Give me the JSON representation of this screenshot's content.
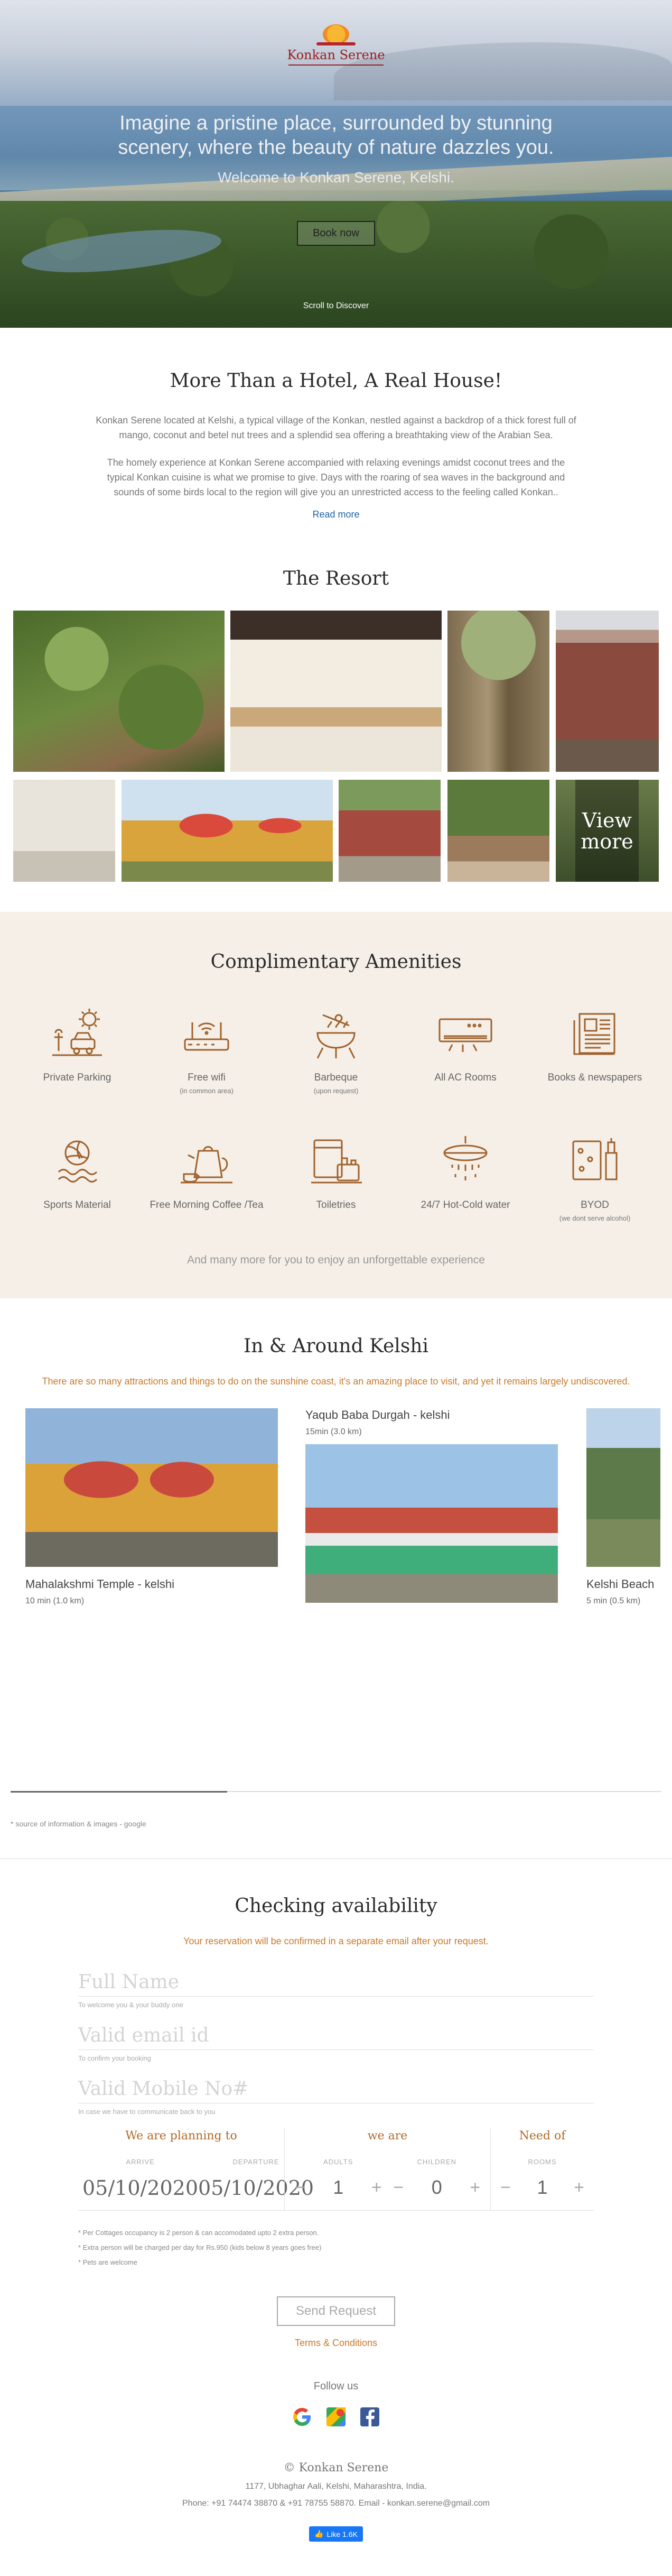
{
  "brand": "Konkan Serene",
  "hero": {
    "tagline": "Imagine a pristine place, surrounded by stunning scenery, where the beauty of nature dazzles you.",
    "welcome": "Welcome to Konkan Serene, Kelshi.",
    "book_label": "Book now",
    "scroll_label": "Scroll to Discover"
  },
  "about": {
    "title": "More Than a Hotel, A Real House!",
    "p1": "Konkan Serene located at Kelshi, a typical village of the Konkan, nestled against a backdrop of a thick forest full of mango, coconut and betel nut trees and a splendid sea offering a breathtaking view of the Arabian Sea.",
    "p2": "The homely experience at Konkan Serene accompanied with relaxing evenings amidst coconut trees and the typical Konkan cuisine is what we promise to give. Days with the roaring of sea waves in the background and sounds of some birds local to the region will give you an unrestricted access to the feeling called Konkan..",
    "read_more": "Read more"
  },
  "resort": {
    "title": "The Resort",
    "view_more": "View more"
  },
  "amenities": {
    "title": "Complimentary Amenities",
    "items": [
      {
        "label": "Private Parking",
        "sub": "",
        "icon": "parking-icon"
      },
      {
        "label": "Free wifi",
        "sub": "(in common area)",
        "icon": "wifi-router-icon"
      },
      {
        "label": "Barbeque",
        "sub": "(upon request)",
        "icon": "barbeque-icon"
      },
      {
        "label": "All AC Rooms",
        "sub": "",
        "icon": "air-conditioner-icon"
      },
      {
        "label": "Books & newspapers",
        "sub": "",
        "icon": "newspaper-icon"
      },
      {
        "label": "Sports Material",
        "sub": "",
        "icon": "volleyball-icon"
      },
      {
        "label": "Free Morning Coffee /Tea",
        "sub": "",
        "icon": "kettle-icon"
      },
      {
        "label": "Toiletries",
        "sub": "",
        "icon": "toiletries-icon"
      },
      {
        "label": "24/7 Hot-Cold water",
        "sub": "",
        "icon": "shower-icon"
      },
      {
        "label": "BYOD",
        "sub": "(we dont serve alcohol)",
        "icon": "drinks-icon"
      }
    ],
    "more": "And many more for you to enjoy an unforgettable experience"
  },
  "around": {
    "title": "In & Around Kelshi",
    "intro": "There are so many attractions and things to do on the sunshine coast, it's an amazing place to visit, and yet it remains largely undiscovered.",
    "places": [
      {
        "name": "Mahalakshmi Temple - kelshi",
        "distance": "10 min (1.0 km)"
      },
      {
        "name": "Yaqub Baba Durgah - kelshi",
        "distance": "15min (3.0 km)"
      },
      {
        "name": "Kelshi Beach",
        "distance": "5 min (0.5 km)"
      }
    ],
    "source": "* source of information & images - google"
  },
  "booking": {
    "title": "Checking availability",
    "note": "Your reservation will be confirmed in a separate email after your request.",
    "name_placeholder": "Full Name",
    "name_help": "To welcome you & your buddy one",
    "email_placeholder": "Valid email id",
    "email_help": "To confirm your booking",
    "mobile_placeholder": "Valid Mobile No#",
    "mobile_help": "In case we have to communicate back to you",
    "planning": "We are planning to",
    "we_are": "we are",
    "need_of": "Need of",
    "arrive_label": "ARRIVE",
    "arrive": "05/10/2020",
    "departure_label": "DEPARTURE",
    "departure": "05/10/2020",
    "adults_label": "ADULTS",
    "adults": "1",
    "children_label": "CHILDREN",
    "children": "0",
    "rooms_label": "ROOMS",
    "rooms": "1",
    "minus": "−",
    "plus": "+",
    "notes": [
      "* Per Cottages occupancy is 2 person & can accomodated upto 2 extra person.",
      "* Extra person will be charged per day for Rs.950 (kids below 8 years goes free)",
      "* Pets are welcome"
    ],
    "send": "Send Request",
    "terms": "Terms & Conditions"
  },
  "footer": {
    "follow": "Follow us",
    "copyright": "© Konkan Serene",
    "address": "1177, Ubhaghar Aali, Kelshi, Maharashtra, India.",
    "phone": "Phone: +91 74474 38870 & +91 78755 58870. Email - konkan.serene@gmail.com",
    "like": "Like 1.6K"
  }
}
